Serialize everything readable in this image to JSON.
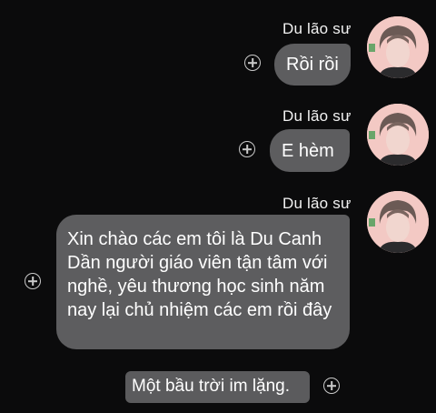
{
  "messages": [
    {
      "sender": "Du lão sư",
      "text": "Rồi rồi"
    },
    {
      "sender": "Du lão sư",
      "text": "E hèm"
    },
    {
      "sender": "Du lão sư",
      "text": "Xin chào các em tôi là Du Canh Dần người giáo viên tận tâm với nghề, yêu thương học sinh năm nay lại chủ nhiệm các em rồi đây"
    }
  ],
  "own_message": {
    "text": "Một bầu trời im lặng."
  },
  "icons": {
    "reaction": "add-reaction-icon",
    "avatar": "avatar-photo"
  },
  "colors": {
    "background": "#0b0b0c",
    "bubble": "#5d5d5f",
    "avatar_bg": "#f3c9c4"
  }
}
